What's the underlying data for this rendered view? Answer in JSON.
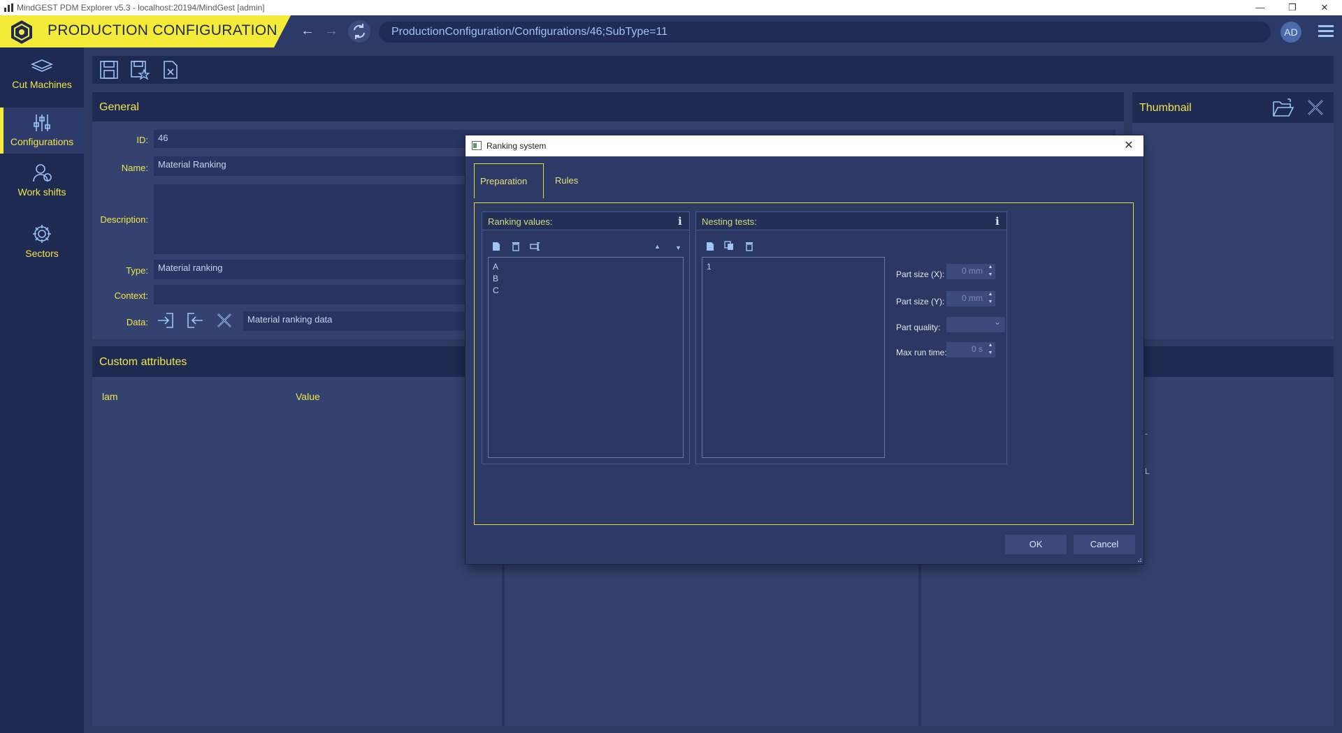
{
  "os": {
    "title": "MindGEST PDM Explorer v5.3 - localhost:20194/MindGest [admin]",
    "minimize": "—",
    "restore": "❐",
    "close": "✕"
  },
  "header": {
    "title": "PRODUCTION CONFIGURATION",
    "back": "←",
    "forward": "→",
    "address": "ProductionConfiguration/Configurations/46;SubType=11",
    "avatar": "AD"
  },
  "sidebar": {
    "items": [
      {
        "label": "Cut Machines",
        "icon": "layers-icon"
      },
      {
        "label": "Configurations",
        "icon": "sliders-icon"
      },
      {
        "label": "Work shifts",
        "icon": "worker-icon"
      },
      {
        "label": "Sectors",
        "icon": "gear-icon"
      }
    ],
    "active": "Configurations"
  },
  "general": {
    "title": "General",
    "id_label": "ID:",
    "id_value": "46",
    "name_label": "Name:",
    "name_value": "Material Ranking",
    "description_label": "Description:",
    "description_value": "",
    "type_label": "Type:",
    "type_value": "Material ranking",
    "context_label": "Context:",
    "context_value": "",
    "data_label": "Data:",
    "data_value": "Material ranking data"
  },
  "thumbnail": {
    "title": "Thumbnail"
  },
  "custom_attributes": {
    "title": "Custom attributes",
    "col_name": "lam",
    "col_value": "Value",
    "right_fragment_1": "-",
    "right_fragment_2": "L"
  },
  "dialog": {
    "title": "Ranking system",
    "close": "✕",
    "tabs": [
      {
        "label": "Preparation"
      },
      {
        "label": "Rules"
      }
    ],
    "active_tab": "Preparation",
    "ranking": {
      "title": "Ranking values:",
      "info": "i",
      "up": "▲",
      "down": "▼",
      "items": [
        "A",
        "B",
        "C"
      ]
    },
    "nesting": {
      "title": "Nesting tests:",
      "info": "i",
      "items": [
        "1"
      ],
      "props": {
        "part_size_x_label": "Part size (X):",
        "part_size_x_value": "0 mm",
        "part_size_y_label": "Part size (Y):",
        "part_size_y_value": "0 mm",
        "part_quality_label": "Part quality:",
        "part_quality_value": "",
        "max_run_time_label": "Max run time:",
        "max_run_time_value": "0 s",
        "spin_up": "▲",
        "spin_down": "▼",
        "dropdown": "⌄"
      }
    },
    "ok": "OK",
    "cancel": "Cancel"
  },
  "colors": {
    "accent": "#f4ea3a",
    "header_bg": "#2c3a68",
    "sidebar_bg": "#1f2a52",
    "panel_bg": "#34426f",
    "link": "#9cc4f6"
  }
}
